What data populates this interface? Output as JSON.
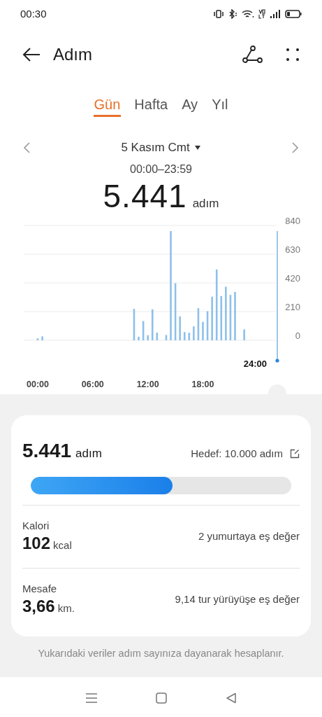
{
  "status_bar": {
    "time": "00:30"
  },
  "header": {
    "title": "Adım"
  },
  "tabs": [
    {
      "label": "Gün",
      "selected": true
    },
    {
      "label": "Hafta",
      "selected": false
    },
    {
      "label": "Ay",
      "selected": false
    },
    {
      "label": "Yıl",
      "selected": false
    }
  ],
  "date": {
    "label": "5 Kasım Cmt",
    "range": "00:00–23:59"
  },
  "total": {
    "value": "5.441",
    "unit": "adım"
  },
  "chart": {
    "cursor_label": "24:00",
    "chart_data": {
      "type": "bar",
      "grid": true,
      "x": [
        0,
        0.5,
        10.5,
        11,
        11.5,
        12,
        12.5,
        13,
        14,
        14.5,
        15,
        15.5,
        16,
        16.5,
        17,
        17.5,
        18,
        18.5,
        19,
        19.5,
        20,
        20.5,
        21,
        21.5,
        22.5
      ],
      "series": [
        {
          "color": "#8ec0ea",
          "values": [
            14,
            29,
            230,
            26,
            141,
            37,
            227,
            56,
            39,
            799,
            417,
            175,
            60,
            55,
            102,
            235,
            135,
            213,
            319,
            518,
            324,
            392,
            332,
            354,
            80
          ]
        }
      ],
      "xlim": [
        -1.5,
        26
      ],
      "ylim": [
        0,
        840
      ],
      "yticks": [
        0,
        210,
        420,
        630,
        840
      ],
      "xticks": [
        {
          "value": 0,
          "label": "00:00"
        },
        {
          "value": 6,
          "label": "06:00"
        },
        {
          "value": 12,
          "label": "12:00"
        },
        {
          "value": 18,
          "label": "18:00"
        }
      ]
    }
  },
  "summary": {
    "steps": "5.441",
    "unit": "adım",
    "goal": "Hedef: 10.000 adım",
    "level": 0.5441,
    "metrics": [
      {
        "label": "Kalori",
        "value": "102",
        "unit": "kcal",
        "equivalent": "2 yumurtaya eş değer"
      },
      {
        "label": "Mesafe",
        "value": "3,66",
        "unit": "km.",
        "equivalent": "9,14 tur yürüyüşe eş değer"
      }
    ]
  },
  "footnote": "Yukarıdaki veriler adım sayınıza dayanarak hesaplanır."
}
